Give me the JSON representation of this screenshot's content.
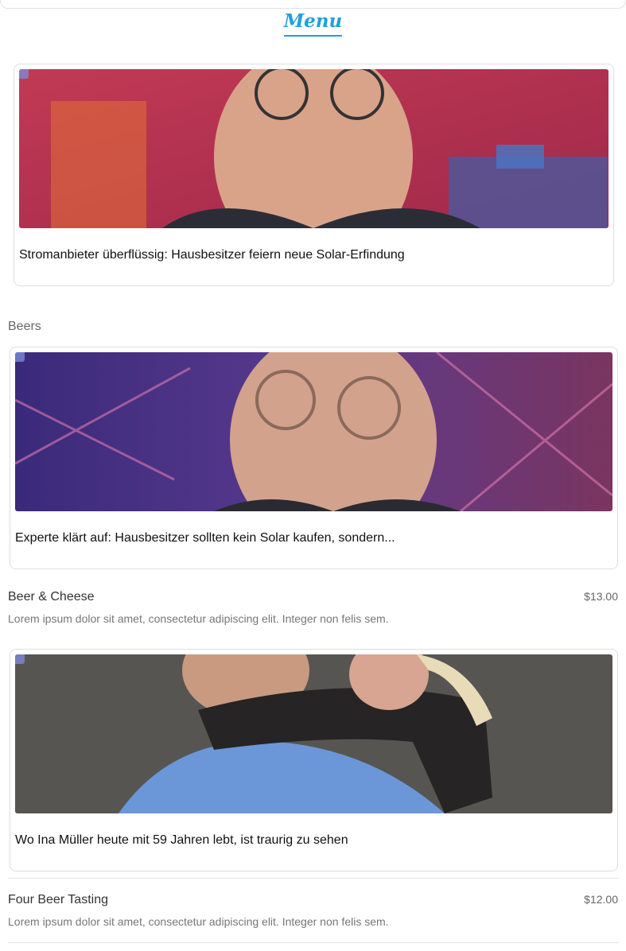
{
  "menu": {
    "title": "Menu"
  },
  "section": {
    "title": "Beers"
  },
  "ads": [
    {
      "headline": "Stromanbieter überflüssig: Hausbesitzer feiern neue Solar-Erfindung"
    },
    {
      "headline": "Experte klärt auf: Hausbesitzer sollten kein Solar kaufen, sondern..."
    },
    {
      "headline": "Wo Ina Müller heute mit 59 Jahren lebt, ist traurig zu sehen"
    }
  ],
  "items": [
    {
      "name": "Beer & Cheese",
      "price": "$13.00",
      "description": "Lorem ipsum dolor sit amet, consectetur adipiscing elit. Integer non felis sem."
    },
    {
      "name": "Four Beer Tasting",
      "price": "$12.00",
      "description": "Lorem ipsum dolor sit amet, consectetur adipiscing elit. Integer non felis sem."
    }
  ],
  "colors": {
    "accent": "#1ea0dc",
    "ad_badge": "#7c8ad8"
  },
  "icons": {
    "ad_badge": "ad-choices-icon"
  }
}
